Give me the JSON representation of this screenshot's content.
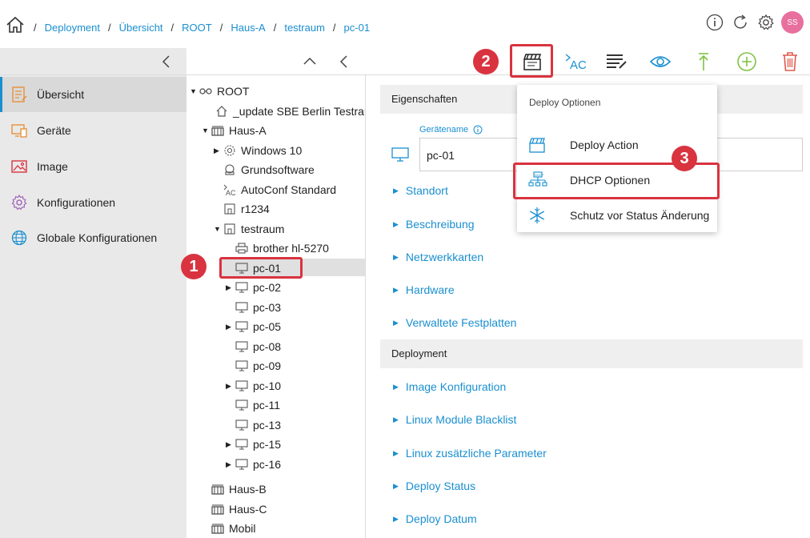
{
  "breadcrumb": {
    "items": [
      "Deployment",
      "Übersicht",
      "ROOT",
      "Haus-A",
      "testraum",
      "pc-01"
    ],
    "separator": "/"
  },
  "user": {
    "initials": "SS",
    "color": "#e8709e"
  },
  "colors": {
    "accent": "#1a8fd0",
    "highlight": "#d9333f",
    "green": "#7dc242",
    "red": "#e05a4e"
  },
  "sidebar": {
    "items": [
      {
        "label": "Übersicht",
        "icon": "overview-icon",
        "active": true
      },
      {
        "label": "Geräte",
        "icon": "devices-icon"
      },
      {
        "label": "Image",
        "icon": "image-icon"
      },
      {
        "label": "Konfigurationen",
        "icon": "configurations-icon"
      },
      {
        "label": "Globale Konfigurationen",
        "icon": "global-configurations-icon"
      }
    ]
  },
  "tree": {
    "nodes": [
      {
        "label": "ROOT",
        "icon": "root-icon",
        "arrow": "▼"
      },
      {
        "label": "_update SBE Berlin Testraum",
        "icon": "home-icon",
        "arrow": ""
      },
      {
        "label": "Haus-A",
        "icon": "building-icon",
        "arrow": "▼"
      },
      {
        "label": "Windows 10",
        "icon": "gear-icon",
        "arrow": "▶"
      },
      {
        "label": "Grundsoftware",
        "icon": "package-icon",
        "arrow": ""
      },
      {
        "label": "AutoConf Standard",
        "icon": "autoconf-icon",
        "arrow": ""
      },
      {
        "label": "r1234",
        "icon": "room-icon",
        "arrow": ""
      },
      {
        "label": "testraum",
        "icon": "room-icon",
        "arrow": "▼"
      },
      {
        "label": "brother hl-5270",
        "icon": "printer-icon",
        "arrow": ""
      },
      {
        "label": "pc-01",
        "icon": "monitor-icon",
        "arrow": ""
      },
      {
        "label": "pc-02",
        "icon": "monitor-icon",
        "arrow": "▶"
      },
      {
        "label": "pc-03",
        "icon": "monitor-icon",
        "arrow": ""
      },
      {
        "label": "pc-05",
        "icon": "monitor-icon",
        "arrow": "▶"
      },
      {
        "label": "pc-08",
        "icon": "monitor-icon",
        "arrow": ""
      },
      {
        "label": "pc-09",
        "icon": "monitor-icon",
        "arrow": ""
      },
      {
        "label": "pc-10",
        "icon": "monitor-icon",
        "arrow": "▶"
      },
      {
        "label": "pc-11",
        "icon": "monitor-icon",
        "arrow": ""
      },
      {
        "label": "pc-13",
        "icon": "monitor-icon",
        "arrow": ""
      },
      {
        "label": "pc-15",
        "icon": "monitor-icon",
        "arrow": "▶"
      },
      {
        "label": "pc-16",
        "icon": "monitor-icon",
        "arrow": "▶"
      },
      {
        "label": "Haus-B",
        "icon": "building-icon",
        "arrow": ""
      },
      {
        "label": "Haus-C",
        "icon": "building-icon",
        "arrow": ""
      },
      {
        "label": "Mobil",
        "icon": "building-icon",
        "arrow": ""
      }
    ]
  },
  "main": {
    "section1": "Eigenschaften",
    "field_label": "Gerätename",
    "field_value": "pc-01",
    "group1": [
      "Standort",
      "Beschreibung",
      "Netzwerkkarten",
      "Hardware",
      "Verwaltete Festplatten"
    ],
    "section2": "Deployment",
    "group2": [
      "Image Konfiguration",
      "Linux Module Blacklist",
      "Linux zusätzliche Parameter",
      "Deploy Status",
      "Deploy Datum"
    ]
  },
  "dropdown": {
    "title": "Deploy Optionen",
    "items": [
      {
        "label": "Deploy Action",
        "icon": "clapperboard-icon"
      },
      {
        "label": "DHCP Optionen",
        "icon": "dhcp-icon"
      },
      {
        "label": "Schutz vor Status Änderung",
        "icon": "snowflake-icon"
      }
    ]
  },
  "annotations": {
    "step1": "1",
    "step2": "2",
    "step3": "3"
  }
}
